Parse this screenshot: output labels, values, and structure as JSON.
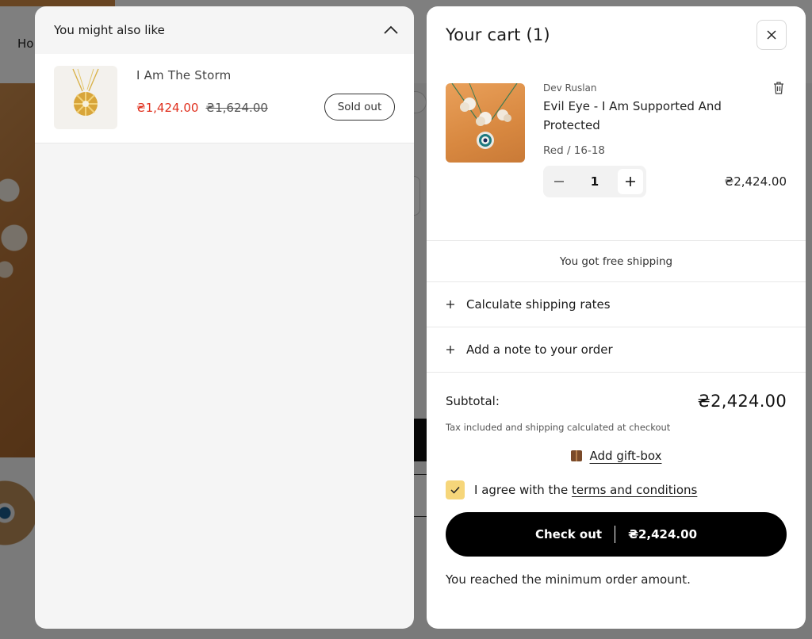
{
  "background": {
    "nav_partial": "Ho"
  },
  "recommendations": {
    "title": "You might also like",
    "items": [
      {
        "name": "I Am The Storm",
        "price": "₴1,424.00",
        "compare_price": "₴1,624.00",
        "button_label": "Sold out"
      }
    ]
  },
  "cart": {
    "title": "Your cart (1)",
    "line_items": [
      {
        "vendor": "Dev Ruslan",
        "title": "Evil Eye - I Am Supported And Protected",
        "variant": "Red / 16-18",
        "quantity": "1",
        "price": "₴2,424.00"
      }
    ],
    "shipping_message": "You got free shipping",
    "accordions": [
      {
        "label": "Calculate shipping rates"
      },
      {
        "label": "Add a note to your order"
      }
    ],
    "subtotal_label": "Subtotal:",
    "subtotal_value": "₴2,424.00",
    "tax_note": "Tax included and shipping calculated at checkout",
    "gift_label": "Add gift-box",
    "terms_prefix": "I agree with the",
    "terms_link": "terms and conditions",
    "checkout_label": "Check out",
    "checkout_price": "₴2,424.00",
    "min_order_note": "You reached the minimum order amount."
  },
  "colors": {
    "sale_red": "#e0301e",
    "checkbox_yellow": "#f6d67a",
    "checkout_black": "#000000"
  }
}
